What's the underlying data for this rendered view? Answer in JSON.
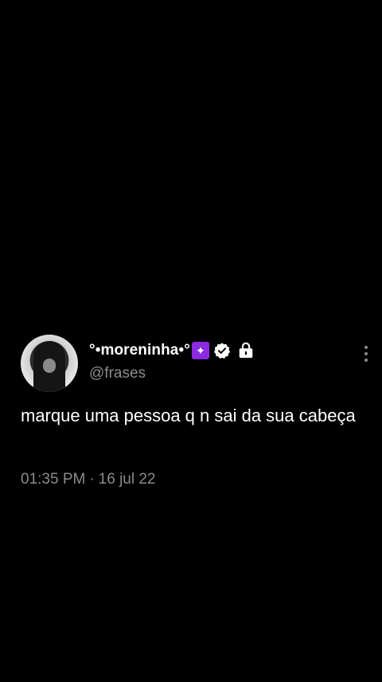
{
  "tweet": {
    "author": {
      "display_name": "°•moreninha•°",
      "handle": "@frases",
      "badge_icon": "purple-square-emoji-icon",
      "verified_icon": "verified-badge-icon",
      "lock_icon": "lock-icon"
    },
    "more_icon": "more-vertical-icon",
    "text": "marque uma pessoa q n sai da sua cabeça",
    "time": "01:35 PM",
    "separator": "·",
    "date": "16 jul 22"
  },
  "colors": {
    "background": "#000000",
    "text_primary": "#ffffff",
    "text_secondary": "#8b8b8b",
    "badge_purple": "#8a2be2"
  }
}
